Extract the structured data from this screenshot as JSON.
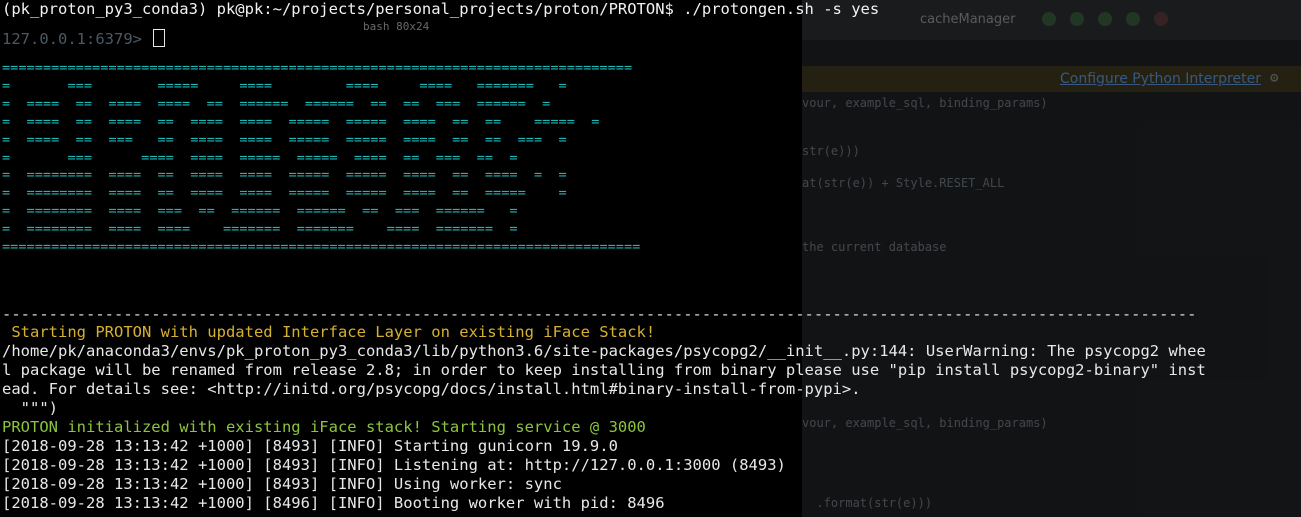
{
  "terminal": {
    "prompt_line": "(pk_proton_py3_conda3) pk@pk:~/projects/personal_projects/proton/PROTON$ ./protongen.sh -s yes",
    "redis_prompt": "127.0.0.1:6379>",
    "tmux_tab": "bash 80x24",
    "ascii_banner": [
      "=============================================================================",
      "=       ===        =====     ====         ====     ====   =======   =",
      "=  ====  ==  ====  ====  ==  ======  ======  ==  ==  ===  ======  =",
      "=  ====  ==  ====  ==  ====  ====  =====  =====  ====  ==  ==    =====  =",
      "=  ====  ==  ===   ==  ====  ====  =====  =====  ====  ==  ==  ===  =",
      "=       ===      ====  ====  =====  =====  ====  ==  ===  ==  =",
      "=  ========  ====  ==  ====  ====  =====  =====  ====  ==  ====  =  =",
      "=  ========  ====  ==  ====  ====  =====  =====  ====  ==  =====    =",
      "=  ========  ====  ===  ==  ======  ======  ==  ===  ======   =",
      "=  ========  ====  ====    =======  =======    ====  =======  =",
      "=============================================================================="
    ],
    "separator": "--------------------------------------------------------------------------------------------------------------------------------",
    "starting_msg": " Starting PROTON with updated Interface Layer on existing iFace Stack!",
    "warning_lines": [
      "/home/pk/anaconda3/envs/pk_proton_py3_conda3/lib/python3.6/site-packages/psycopg2/__init__.py:144: UserWarning: The psycopg2 whee",
      "l package will be renamed from release 2.8; in order to keep installing from binary please use \"pip install psycopg2-binary\" inst",
      "ead. For details see: <http://initd.org/psycopg/docs/install.html#binary-install-from-pypi>.",
      "  \"\"\")"
    ],
    "init_msg": "PROTON initialized with existing iFace stack! Starting service @ 3000",
    "log_lines": [
      "[2018-09-28 13:13:42 +1000] [8493] [INFO] Starting gunicorn 19.9.0",
      "[2018-09-28 13:13:42 +1000] [8493] [INFO] Listening at: http://127.0.0.1:3000 (8493)",
      "[2018-09-28 13:13:42 +1000] [8493] [INFO] Using worker: sync",
      "[2018-09-28 13:13:42 +1000] [8496] [INFO] Booting worker with pid: 8496"
    ]
  },
  "ide": {
    "run_config": "cacheManager",
    "banner_link": "Configure Python Interpreter",
    "code_lines": [
      "vour, example_sql, binding_params)",
      "",
      "",
      "str(e)))",
      "",
      "at(str(e)) + Style.RESET_ALL",
      "",
      "",
      "",
      "the current database",
      "",
      "",
      "",
      "",
      "",
      "",
      "",
      "",
      "",
      "",
      "vour, example_sql, binding_params)",
      "",
      "",
      "",
      "",
      "  .format(str(e)))"
    ]
  },
  "colors": {
    "banner": "#20b6b6",
    "starting": "#d6b12f",
    "init": "#8bc53f",
    "text": "#e8e8e8"
  }
}
